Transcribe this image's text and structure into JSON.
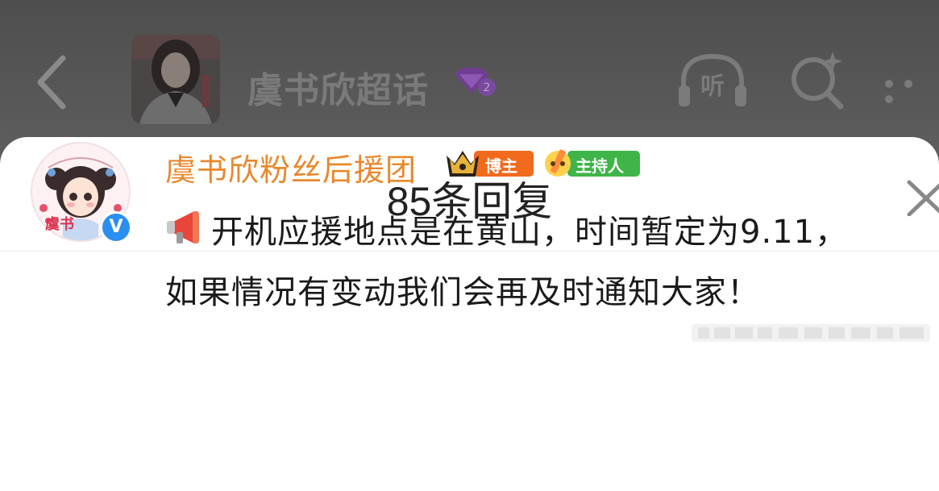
{
  "header": {
    "topic_title": "虞书欣超话",
    "level_badge": "2",
    "listen_label": "听",
    "icons": [
      "back-arrow-icon",
      "headphones-icon",
      "search-sparkle-icon",
      "more-dots-icon"
    ]
  },
  "sheet": {
    "title": "85条回复",
    "icons": [
      "refresh-icon",
      "close-icon"
    ]
  },
  "reply": {
    "username": "虞书欣粉丝后援团",
    "avatar_caption": "虞书",
    "verified_mark": "V",
    "badges": {
      "host": "博主",
      "mc": "主持人"
    },
    "text_line1": "开机应援地点是在黄山，时间暂定为9.11，",
    "text_line2": "如果情况有变动我们会再及时通知大家！",
    "icons": [
      "megaphone-icon",
      "crown-icon",
      "pencil-icon",
      "verified-icon"
    ]
  },
  "colors": {
    "username": "#e8882d",
    "host_badge": "#f26b1d",
    "mc_badge": "#3fb548",
    "verified": "#2b8ff0",
    "level_badge": "#8a4bb8"
  }
}
